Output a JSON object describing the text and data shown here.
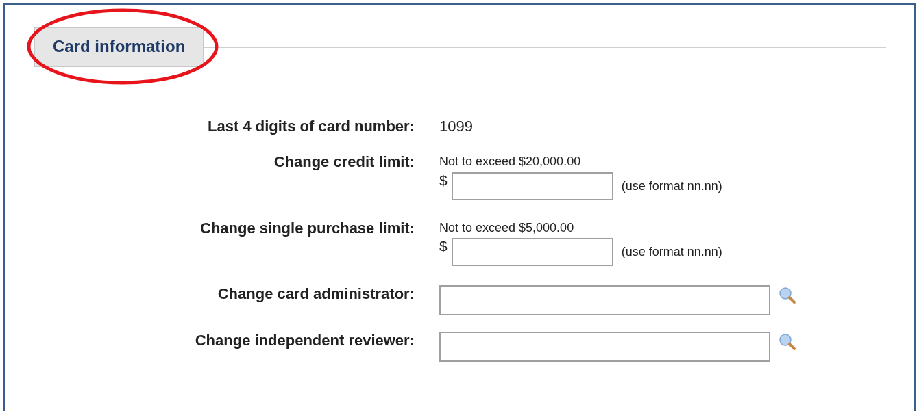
{
  "section": {
    "legend": "Card information",
    "highlighted": true
  },
  "fields": [
    {
      "kind": "text",
      "label": "Last 4 digits of card number:",
      "value": "1099"
    },
    {
      "kind": "amount",
      "label": "Change credit limit:",
      "hint": "Not to exceed $20,000.00",
      "currency": "$",
      "format_note": "(use format nn.nn)"
    },
    {
      "kind": "amount",
      "label": "Change single purchase limit:",
      "hint": "Not to exceed $5,000.00",
      "currency": "$",
      "format_note": "(use format nn.nn)"
    },
    {
      "kind": "lookup",
      "label": "Change card administrator:"
    },
    {
      "kind": "lookup",
      "label": "Change independent reviewer:"
    }
  ]
}
